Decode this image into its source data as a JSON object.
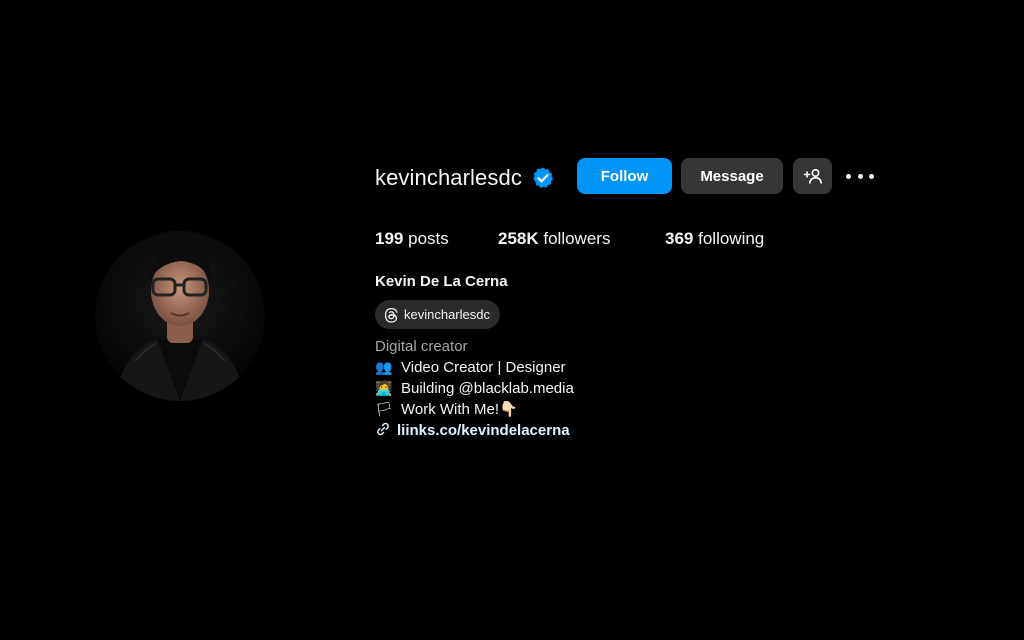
{
  "profile": {
    "username": "kevincharlesdc",
    "full_name": "Kevin De La Cerna",
    "threads_handle": "kevincharlesdc",
    "category": "Digital creator",
    "bio": [
      {
        "icon": "people-emoji",
        "glyph": "👥",
        "text": "Video Creator | Designer"
      },
      {
        "icon": "technologist-emoji",
        "glyph": "🧑‍💻",
        "text": "Building @blacklab.media"
      },
      {
        "icon": "flag-emoji",
        "glyph": "🏳",
        "text": "Work With Me!👇🏻"
      }
    ],
    "link": "liinks.co/kevindelacerna"
  },
  "actions": {
    "follow_label": "Follow",
    "message_label": "Message"
  },
  "stats": {
    "posts_count": "199",
    "posts_label": "posts",
    "followers_count": "258K",
    "followers_label": "followers",
    "following_count": "369",
    "following_label": "following"
  },
  "colors": {
    "follow_button": "#0095f6",
    "secondary_button": "#363636",
    "verified_badge": "#0095f6",
    "background": "#000000"
  },
  "icons": [
    "verified-badge-icon",
    "add-user-icon",
    "more-options-icon",
    "threads-icon",
    "link-icon"
  ]
}
